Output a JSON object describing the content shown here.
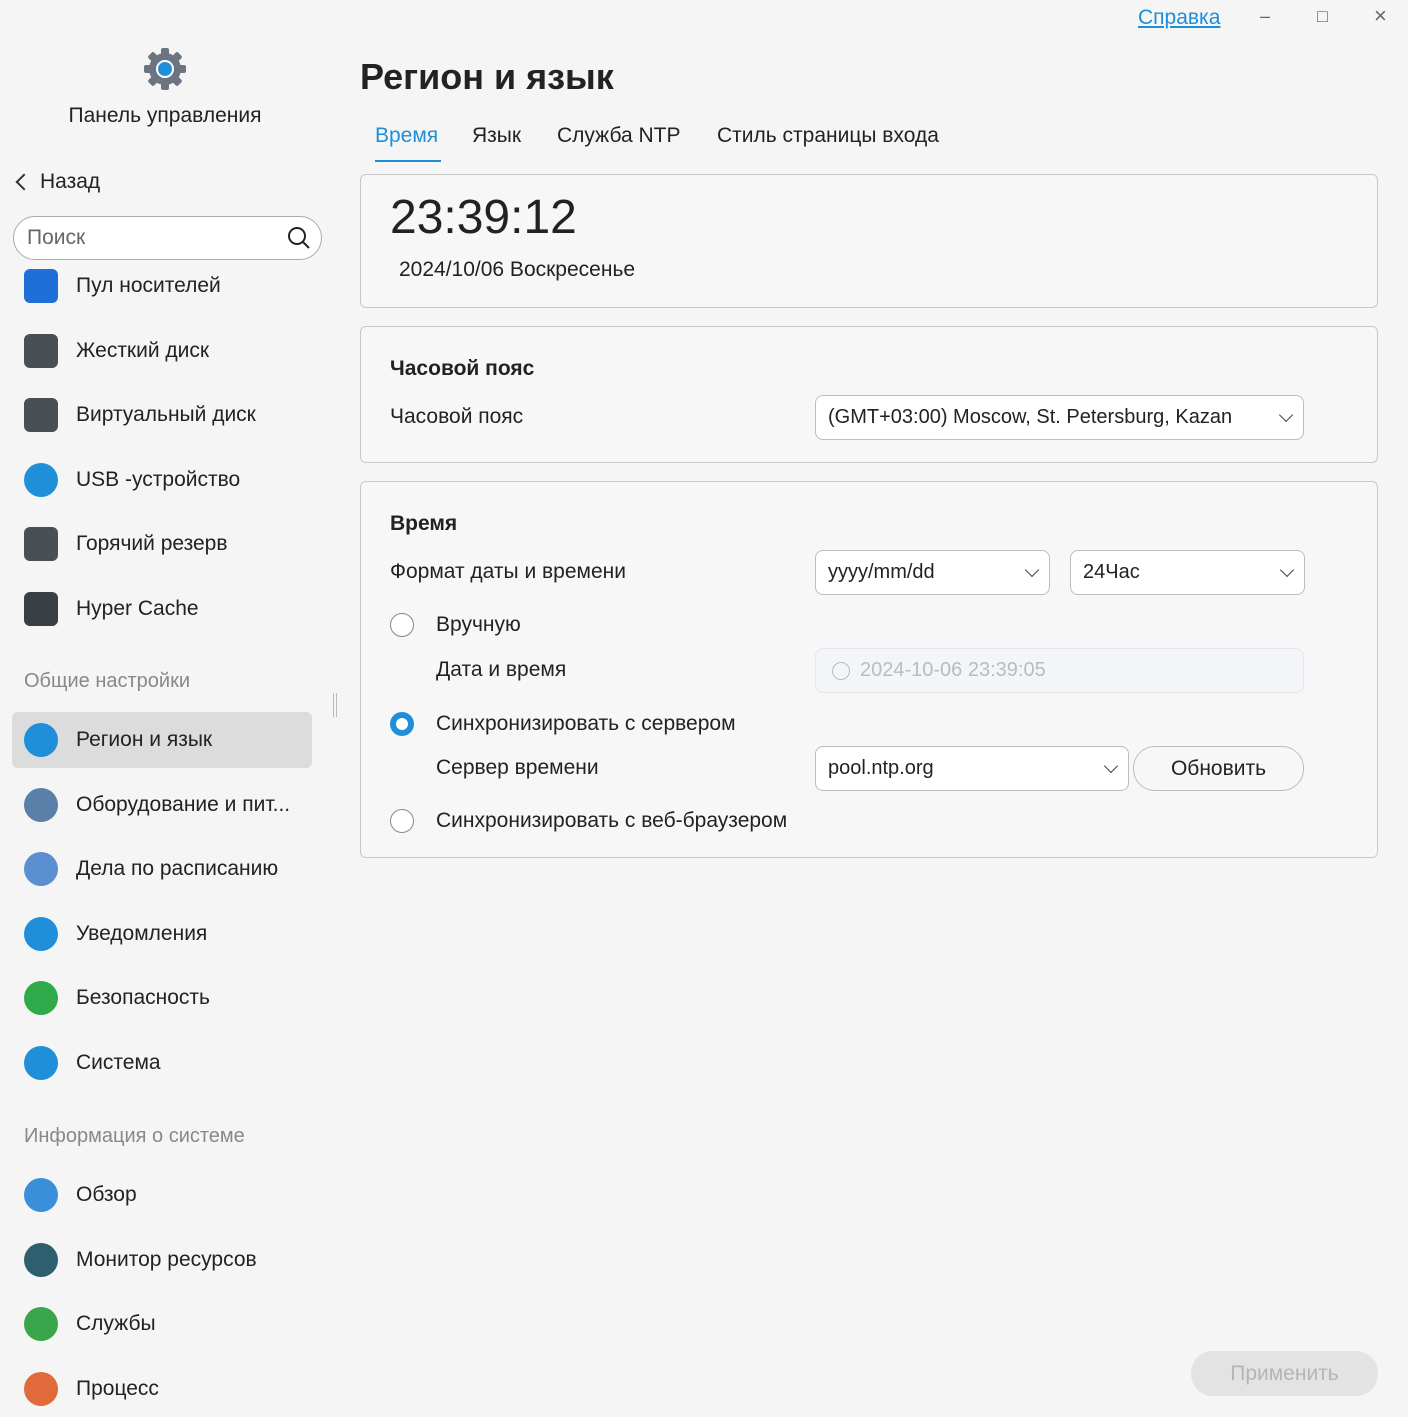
{
  "app": {
    "title": "Панель управления",
    "back": "Назад",
    "search_placeholder": "Поиск"
  },
  "window": {
    "help": "Справка",
    "minimize": "–",
    "maximize": "□",
    "close": "×"
  },
  "sidebar": {
    "storage": [
      {
        "label": "Пул носителей",
        "color": "#1e6fd8"
      },
      {
        "label": "Жесткий диск",
        "color": "#4a4f55"
      },
      {
        "label": "Виртуальный диск",
        "color": "#4a4f55"
      },
      {
        "label": "USB -устройство",
        "color": "#1e8fd8"
      },
      {
        "label": "Горячий резерв",
        "color": "#4a4f55"
      },
      {
        "label": "Hyper Cache",
        "color": "#3a3f45"
      }
    ],
    "general_header": "Общие настройки",
    "general": [
      {
        "label": "Регион и язык",
        "color": "#1e8fd8"
      },
      {
        "label": "Оборудование и пит...",
        "color": "#5a7fa8"
      },
      {
        "label": "Дела по расписанию",
        "color": "#5b8fd0"
      },
      {
        "label": "Уведомления",
        "color": "#1e8fd8"
      },
      {
        "label": "Безопасность",
        "color": "#2faa4a"
      },
      {
        "label": "Система",
        "color": "#1e8fd8"
      }
    ],
    "info_header": "Информация о системе",
    "info": [
      {
        "label": "Обзор",
        "color": "#3a8fd8"
      },
      {
        "label": "Монитор ресурсов",
        "color": "#2e5f6e"
      },
      {
        "label": "Службы",
        "color": "#3aa54a"
      },
      {
        "label": "Процесс",
        "color": "#e06a3a"
      }
    ]
  },
  "main": {
    "title": "Регион и язык",
    "tabs": [
      "Время",
      "Язык",
      "Служба NTP",
      "Стиль страницы входа"
    ],
    "clock": "23:39:12",
    "date": "2024/10/06 Воскресенье",
    "timezone": {
      "section": "Часовой пояс",
      "label": "Часовой пояс",
      "value": "(GMT+03:00) Moscow, St. Petersburg, Kazan"
    },
    "time": {
      "section": "Время",
      "format_label": "Формат даты и времени",
      "date_format": "yyyy/mm/dd",
      "hour_format": "24Час",
      "manual": "Вручную",
      "datetime_label": "Дата и время",
      "datetime_value": "2024-10-06 23:39:05",
      "sync_server": "Синхронизировать с сервером",
      "server_label": "Сервер времени",
      "server_value": "pool.ntp.org",
      "update": "Обновить",
      "sync_browser": "Синхронизировать с веб-браузером"
    },
    "apply": "Применить"
  }
}
